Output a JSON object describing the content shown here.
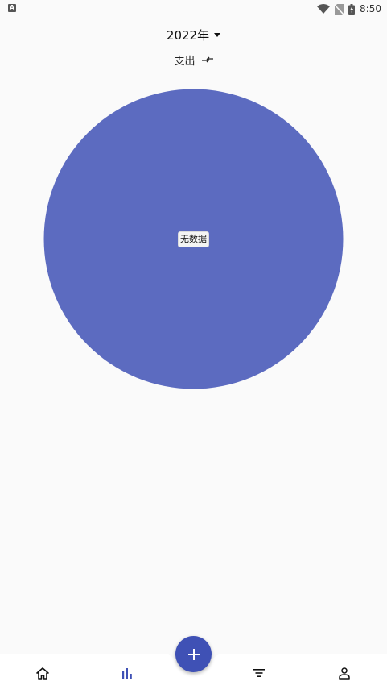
{
  "status_bar": {
    "left_badge": "A",
    "time": "8:50",
    "icons": [
      "wifi-icon",
      "no-sim-icon",
      "battery-charging-icon"
    ]
  },
  "header": {
    "year": "2022年",
    "type_label": "支出"
  },
  "pie": {
    "label": "无数据",
    "color": "#5c6bc0"
  },
  "colors": {
    "primary": "#3f51b5",
    "background": "#fafafa"
  },
  "bottom_nav": {
    "items": [
      {
        "icon": "home-icon",
        "active": false
      },
      {
        "icon": "bar-chart-icon",
        "active": true
      },
      {
        "icon": "add-icon",
        "active": false
      },
      {
        "icon": "filter-icon",
        "active": false
      },
      {
        "icon": "person-icon",
        "active": false
      }
    ]
  }
}
